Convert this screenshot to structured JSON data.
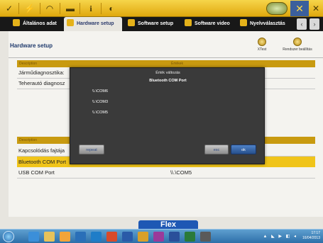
{
  "tabs": [
    {
      "label": "Általános adat"
    },
    {
      "label": "Hardware setup"
    },
    {
      "label": "Software setup"
    },
    {
      "label": "Software video"
    },
    {
      "label": "Nyelvválasztás"
    }
  ],
  "page": {
    "title": "Hardware setup",
    "tool_buttons": [
      {
        "label": "XTest"
      },
      {
        "label": "Rendszer beállítás"
      }
    ]
  },
  "table1": {
    "headers": [
      "Description",
      "Értékek"
    ],
    "rows": [
      {
        "description": "Járműdiagnosztika:"
      },
      {
        "description": "Teherautó diagnosz"
      }
    ]
  },
  "table2": {
    "headers": [
      "Description"
    ],
    "rows": [
      {
        "description": "Kapcsolódás fajtája",
        "value": ""
      },
      {
        "description": "Bluetooth COM Port",
        "value": ""
      },
      {
        "description": "USB COM Port",
        "value": "\\\\.\\COM5"
      }
    ]
  },
  "dialog": {
    "title": "Érték változás",
    "subtitle": "Bluetooth COM Port",
    "options": [
      "\\\\.\\COM6",
      "\\\\.\\COM3",
      "\\\\.\\COM5"
    ],
    "repeat_label": "repeat",
    "esc_label": "esc",
    "ok_label": "ok"
  },
  "footer": {
    "brand": "Flex"
  },
  "taskbar": {
    "time": "17:17",
    "date": "16/04/2013"
  },
  "colors": {
    "accent": "#f0c41a",
    "header_bar": "#c89a10",
    "tab_bar": "#181818",
    "dialog_bg": "#3a3a3a"
  }
}
